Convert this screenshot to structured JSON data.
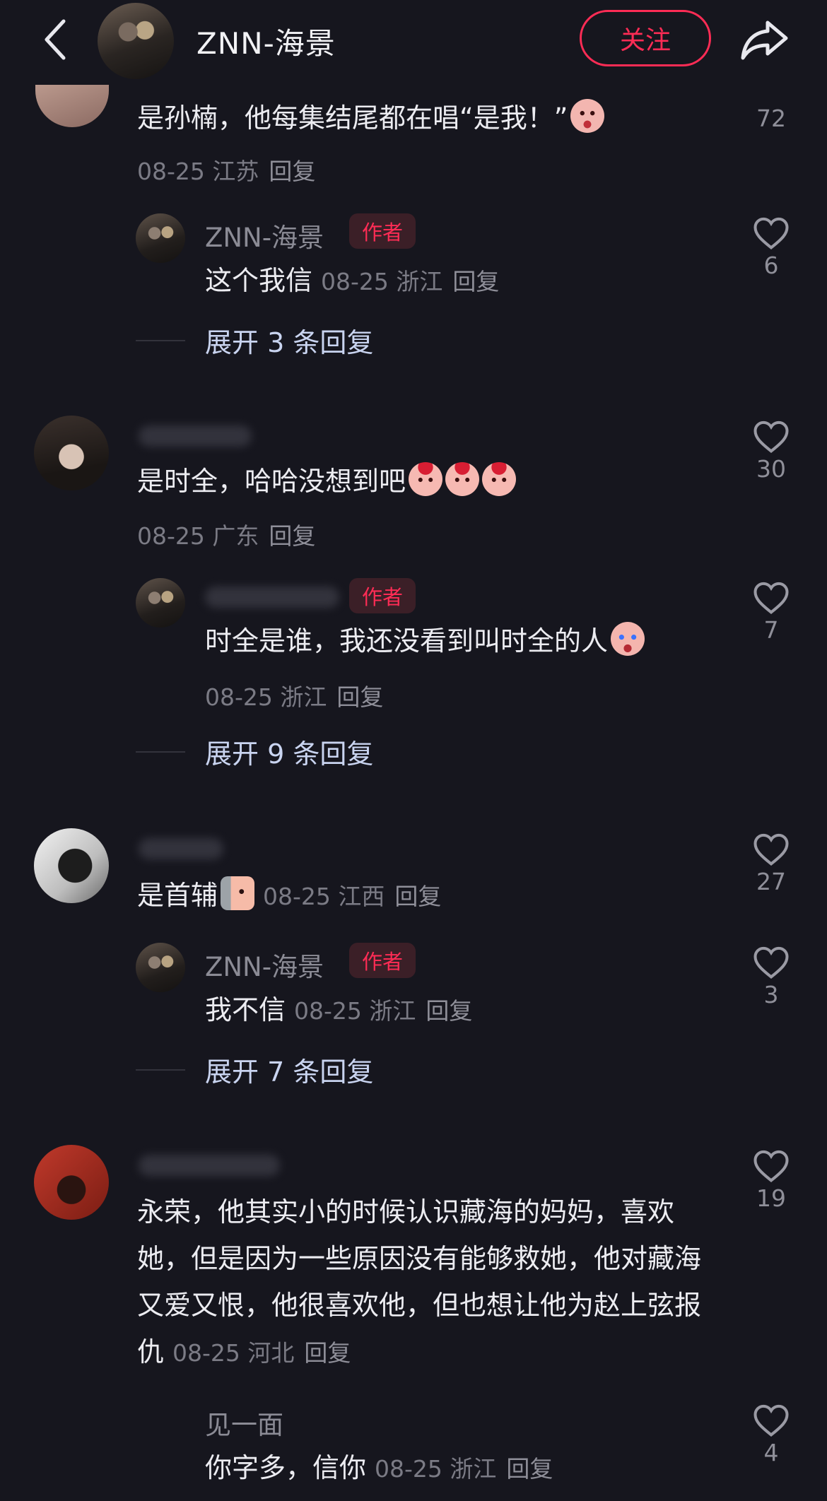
{
  "header": {
    "title": "ZNN-海景",
    "follow_label": "关注"
  },
  "comments": [
    {
      "id": "c1",
      "text": "是孙楠，他每集结尾都在唱“是我！”",
      "meta": "08-25 江苏",
      "reply_label": "回复",
      "likes": "72",
      "reply": {
        "name": "ZNN-海景",
        "tag": "作者",
        "text": "这个我信",
        "meta": "08-25 浙江",
        "reply_label": "回复",
        "likes": "6"
      },
      "expand_label": "展开 3 条回复"
    },
    {
      "id": "c2",
      "text": "是时全，哈哈没想到吧",
      "meta": "08-25 广东",
      "reply_label": "回复",
      "likes": "30",
      "reply": {
        "tag": "作者",
        "text": "时全是谁，我还没看到叫时全的人",
        "meta": "08-25 浙江",
        "reply_label": "回复",
        "likes": "7"
      },
      "expand_label": "展开 9 条回复"
    },
    {
      "id": "c3",
      "text": "是首辅",
      "meta": "08-25 江西",
      "reply_label": "回复",
      "likes": "27",
      "reply": {
        "name": "ZNN-海景",
        "tag": "作者",
        "text": "我不信",
        "meta": "08-25 浙江",
        "reply_label": "回复",
        "likes": "3"
      },
      "expand_label": "展开 7 条回复"
    },
    {
      "id": "c4",
      "text": "永荣，他其实小的时候认识藏海的妈妈，喜欢她，但是因为一些原因没有能够救她，他对藏海又爱又恨，他很喜欢他，但也想让他为赵上弦报仇",
      "meta": "08-25 河北",
      "reply_label": "回复",
      "likes": "19",
      "reply": {
        "name": "见一面",
        "text": "你字多，信你",
        "meta": "08-25 浙江",
        "reply_label": "回复",
        "likes": "4"
      }
    }
  ],
  "icons": {
    "back": "chevron-left-icon",
    "share": "share-arrow-icon",
    "like": "heart-outline-icon"
  },
  "colors": {
    "background": "#16161e",
    "accent": "#fe2c55",
    "expand_text": "#c9d4f0"
  }
}
